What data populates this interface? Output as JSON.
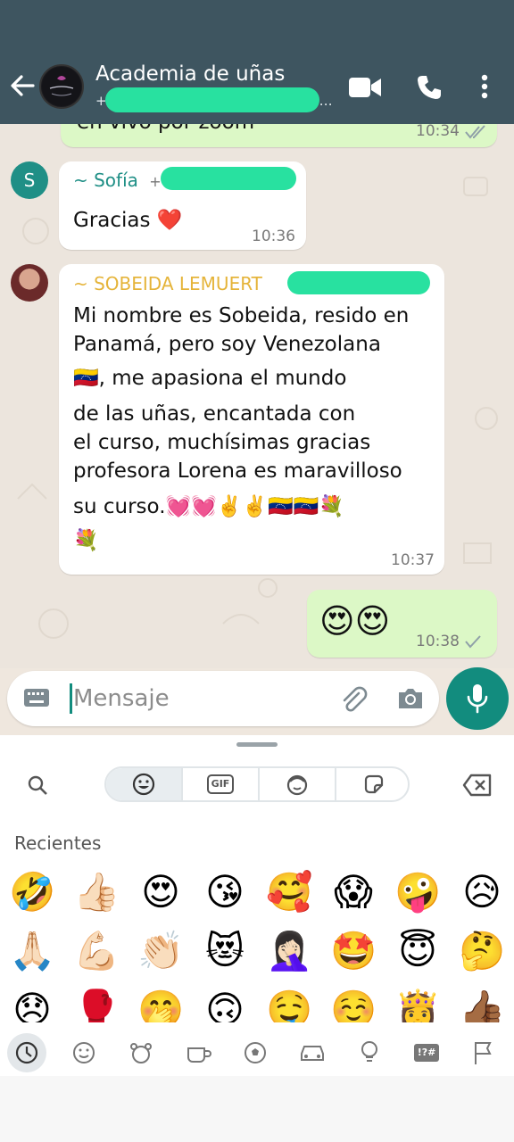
{
  "header": {
    "title": "Academia de uñas",
    "subtitle": "+",
    "subtitle_tail": "…",
    "back_icon": "arrow-left-icon",
    "video_icon": "video-call-icon",
    "call_icon": "phone-icon",
    "menu_icon": "more-vert-icon"
  },
  "messages": [
    {
      "id": "m0",
      "direction": "out",
      "text": "en vivo por zoom",
      "time": "10:34",
      "status": "read"
    },
    {
      "id": "m1",
      "direction": "in",
      "sender": "~ Sofía",
      "sender_suffix": "+",
      "avatar_letter": "S",
      "text": "Gracias ❤️",
      "time": "10:36"
    },
    {
      "id": "m2",
      "direction": "in",
      "sender": "~ SOBEIDA LEMUERT",
      "lines": [
        "Mi nombre es Sobeida, resido en",
        "Panamá, pero soy Venezolana",
        "🇻🇪, me apasiona el mundo",
        "de las uñas, encantada con",
        "el curso, muchísimas gracias",
        "profesora Lorena es maravilloso",
        "su curso.💓💓✌️✌️🇻🇪🇻🇪💐",
        "💐"
      ],
      "time": "10:37"
    },
    {
      "id": "m3",
      "direction": "out",
      "text": "😍😍",
      "time": "10:38",
      "status": "delivered"
    }
  ],
  "composer": {
    "placeholder": "Mensaje",
    "keyboard_icon": "keyboard-icon",
    "attach_icon": "paperclip-icon",
    "camera_icon": "camera-icon",
    "mic_icon": "microphone-icon"
  },
  "keyboard": {
    "tabs": [
      "emoji",
      "GIF",
      "avatar",
      "sticker"
    ],
    "gif_label": "GIF",
    "recent_label": "Recientes",
    "emoji_rows": [
      [
        "🤣",
        "👍🏻",
        "😍",
        "😘",
        "🥰",
        "😱",
        "🤪",
        "😥"
      ],
      [
        "🙏🏻",
        "💪🏻",
        "👏🏻",
        "😻",
        "🤦🏻‍♀️",
        "🤩",
        "😇",
        "🤔"
      ],
      [
        "😞",
        "🥊",
        "🤭",
        "🙃",
        "🤤",
        "☺️",
        "👸",
        "👍🏾"
      ]
    ],
    "categories": [
      "recent-icon",
      "smiley-icon",
      "animal-icon",
      "food-icon",
      "activity-icon",
      "travel-icon",
      "objects-icon",
      "symbols-icon",
      "flag-icon"
    ],
    "symbols_label": "!?#"
  },
  "colors": {
    "header_bg": "#3e5560",
    "accent": "#128c7e",
    "out_bubble": "#dcf8c6",
    "sobeida_name": "#e5b43a",
    "sofia_name": "#1f8f86",
    "read_check": "#4fb6ec"
  }
}
